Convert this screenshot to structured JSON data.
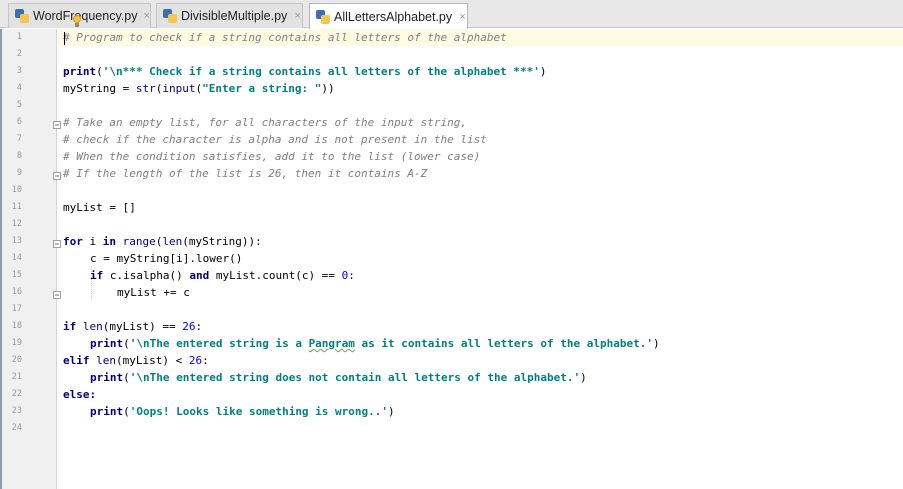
{
  "tabs": [
    {
      "label": "WordFrequency.py",
      "close": "×"
    },
    {
      "label": "DivisibleMultiple.py",
      "close": "×"
    },
    {
      "label": "AllLettersAlphabet.py",
      "close": "×"
    }
  ],
  "line_numbers": [
    "1",
    "2",
    "3",
    "4",
    "5",
    "6",
    "7",
    "8",
    "9",
    "10",
    "11",
    "12",
    "13",
    "14",
    "15",
    "16",
    "17",
    "18",
    "19",
    "20",
    "21",
    "22",
    "23",
    "24"
  ],
  "code": {
    "l1_comment": "# Program to check if a string contains all letters of the alphabet",
    "l3_print": "print",
    "l3_open": "(",
    "l3_str": "'\\n*** Check if a string contains all letters of the alphabet ***'",
    "l3_close": ")",
    "l4_a": "myString = ",
    "l4_str_fn": "str",
    "l4_b": "(",
    "l4_input": "input",
    "l4_c": "(",
    "l4_str": "\"Enter a string: \"",
    "l4_d": "))",
    "l6_comment": "# Take an empty list, for all characters of the input string,",
    "l7_comment": "# check if the character is alpha and is not present in the list",
    "l8_comment": "# When the condition satisfies, add it to the list (lower case)",
    "l9_comment": "# If the length of the list is 26, then it contains A-Z",
    "l11_code": "myList = []",
    "l13_for": "for",
    "l13_a": " i ",
    "l13_in": "in",
    "l13_sp": " ",
    "l13_range": "range",
    "l13_b": "(",
    "l13_len": "len",
    "l13_c": "(myString)):",
    "l14_code": "c = myString[i].lower()",
    "l15_if": "if",
    "l15_a": " c.isalpha() ",
    "l15_and": "and",
    "l15_b": " myList.count(c) == ",
    "l15_num": "0",
    "l15_c": ":",
    "l16_code": "myList += c",
    "l18_if": "if",
    "l18_sp": " ",
    "l18_len": "len",
    "l18_a": "(myList) == ",
    "l18_num": "26",
    "l18_b": ":",
    "l19_print": "print",
    "l19_open": "(",
    "l19_s1": "'\\nThe entered string is a ",
    "l19_s2": "Pangram",
    "l19_s3": " as it contains all letters of the alphabet.'",
    "l19_close": ")",
    "l20_elif": "elif",
    "l20_sp": " ",
    "l20_len": "len",
    "l20_a": "(myList) < ",
    "l20_num": "26",
    "l20_b": ":",
    "l21_print": "print",
    "l21_open": "(",
    "l21_str": "'\\nThe entered string does not contain all letters of the alphabet.'",
    "l21_close": ")",
    "l22_else": "else:",
    "l23_print": "print",
    "l23_open": "(",
    "l23_str": "'Oops! Looks like something is wrong..'",
    "l23_close": ")"
  },
  "colors": {
    "comment": "#808080",
    "keyword": "#000080",
    "string": "#008080",
    "number": "#0000ff",
    "current_line": "#fffae3"
  },
  "icons": [
    "python-file-icon",
    "close-icon",
    "lightbulb-icon",
    "fold-icon"
  ]
}
